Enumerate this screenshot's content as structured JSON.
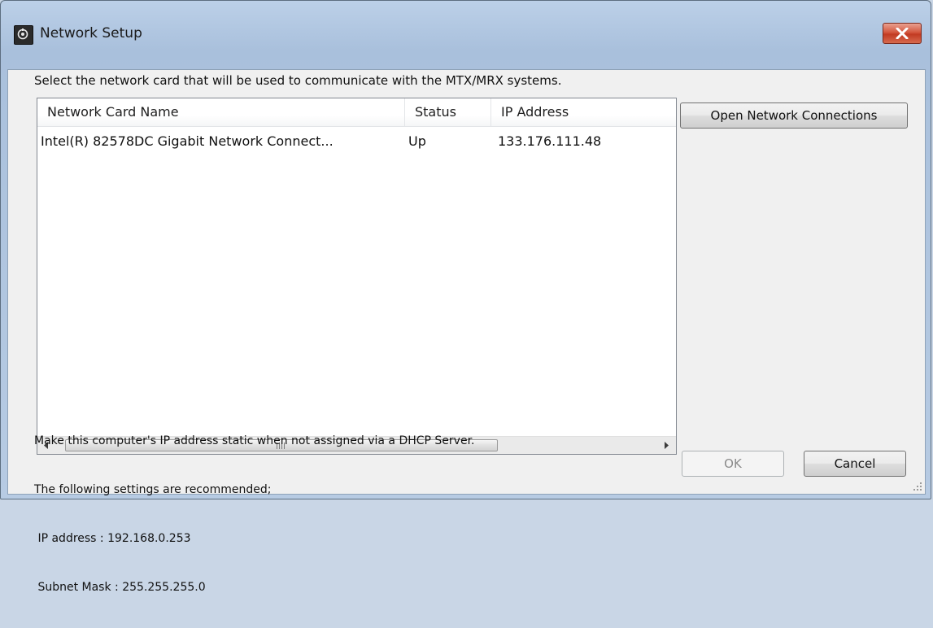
{
  "window": {
    "title": "Network Setup",
    "close_glyph": "✕"
  },
  "instruction": "Select the network card that will be used to communicate with the MTX/MRX systems.",
  "table": {
    "columns": [
      "Network Card Name",
      "Status",
      "IP Address"
    ],
    "rows": [
      {
        "name": "Intel(R) 82578DC Gigabit Network Connect...",
        "status": "Up",
        "ip": "133.176.111.48"
      }
    ],
    "scroll_grip": "III"
  },
  "buttons": {
    "open_network": "Open Network Connections",
    "ok": "OK",
    "cancel": "Cancel"
  },
  "note": {
    "line1": "Make this computer's IP address static when not assigned via a DHCP Server.",
    "line2": "The following settings are recommended;",
    "line3": " IP address : 192.168.0.253",
    "line4": " Subnet Mask : 255.255.255.0"
  },
  "icons": {
    "app": "app-icon",
    "close": "close-icon",
    "scroll_left": "chevron-left-icon",
    "scroll_right": "chevron-right-icon",
    "resize": "resize-grip-icon"
  },
  "colors": {
    "close_button": "#d4573e",
    "dialog_background": "#f0f0f0"
  }
}
